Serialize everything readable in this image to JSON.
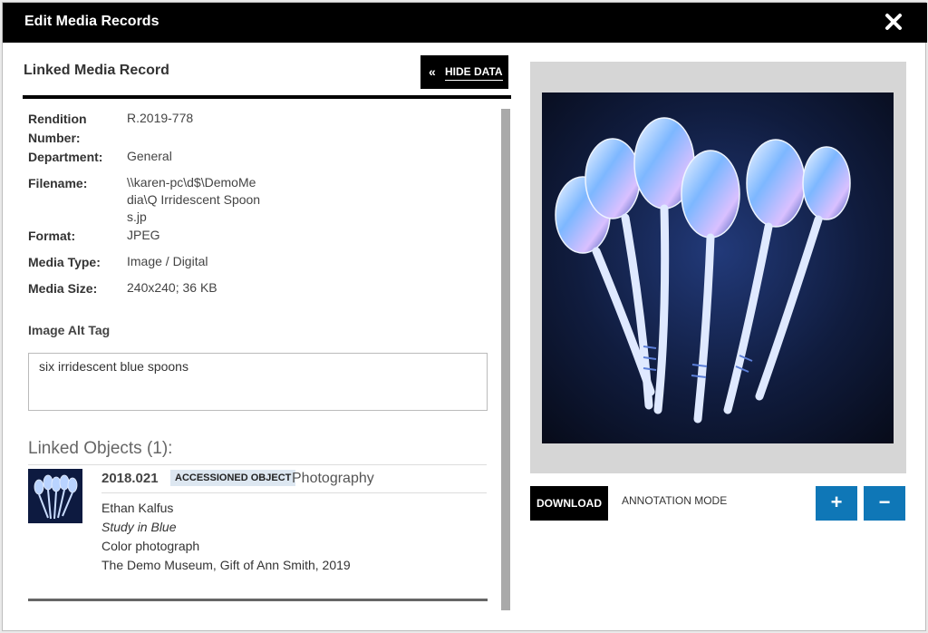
{
  "modal": {
    "title": "Edit Media Records",
    "close_icon": "close-icon"
  },
  "panel": {
    "title": "Linked Media Record",
    "hide_label": "HIDE DATA"
  },
  "fields": {
    "rendition": {
      "label": "Rendition Number:",
      "value": "R.2019-778"
    },
    "department": {
      "label": "Department:",
      "value": "General"
    },
    "filename": {
      "label": "Filename:",
      "value": "\\\\karen-pc\\d$\\DemoMedia\\Q Irridescent Spoons.jp"
    },
    "format": {
      "label": "Format:",
      "value": "JPEG"
    },
    "media_type": {
      "label": "Media Type:",
      "value": "Image / Digital"
    },
    "media_size": {
      "label": "Media Size:",
      "value": "240x240; 36 KB"
    }
  },
  "alt_tag": {
    "label": "Image Alt Tag",
    "value": "six irridescent blue spoons"
  },
  "linked": {
    "title": "Linked Objects (1):",
    "object": {
      "number": "2018.021",
      "badge": "ACCESSIONED OBJECT",
      "type": "Photography",
      "maker": "Ethan Kalfus",
      "title": "Study in Blue",
      "medium": "Color photograph",
      "credit": "The Demo Museum, Gift of Ann Smith, 2019"
    }
  },
  "actions": {
    "download": "DOWNLOAD",
    "annotation": "ANNOTATION MODE",
    "zoom_in": "+",
    "zoom_out": "−"
  },
  "colors": {
    "accent": "#0f77b7",
    "titlebar": "#000000",
    "badge_bg": "#dde7f1"
  }
}
